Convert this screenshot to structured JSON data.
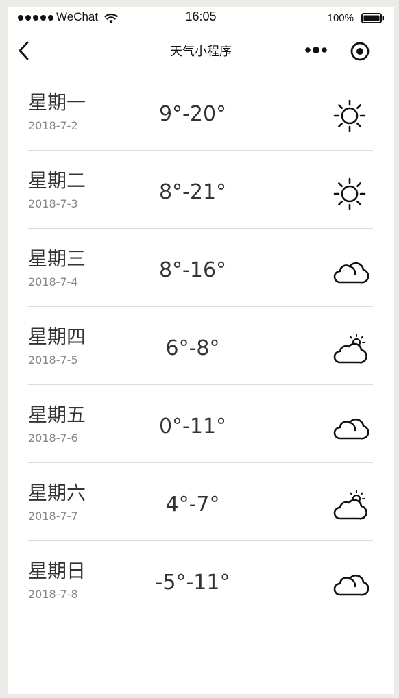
{
  "status_bar": {
    "carrier": "WeChat",
    "time": "16:05",
    "battery_percent": "100%"
  },
  "nav": {
    "title": "天气小程序"
  },
  "forecast": [
    {
      "day": "星期一",
      "date": "2018-7-2",
      "temp": "9°-20°",
      "icon": "sun-icon"
    },
    {
      "day": "星期二",
      "date": "2018-7-3",
      "temp": "8°-21°",
      "icon": "sun-icon"
    },
    {
      "day": "星期三",
      "date": "2018-7-4",
      "temp": "8°-16°",
      "icon": "cloud-icon"
    },
    {
      "day": "星期四",
      "date": "2018-7-5",
      "temp": "6°-8°",
      "icon": "partly-cloudy-icon"
    },
    {
      "day": "星期五",
      "date": "2018-7-6",
      "temp": "0°-11°",
      "icon": "cloud-icon"
    },
    {
      "day": "星期六",
      "date": "2018-7-7",
      "temp": "4°-7°",
      "icon": "partly-cloudy-icon"
    },
    {
      "day": "星期日",
      "date": "2018-7-8",
      "temp": "-5°-11°",
      "icon": "cloud-icon"
    }
  ],
  "colors": {
    "background": "#ecebe7",
    "surface": "#ffffff",
    "text_primary": "#333333",
    "text_secondary": "#888888",
    "divider": "#dcdcdc"
  }
}
